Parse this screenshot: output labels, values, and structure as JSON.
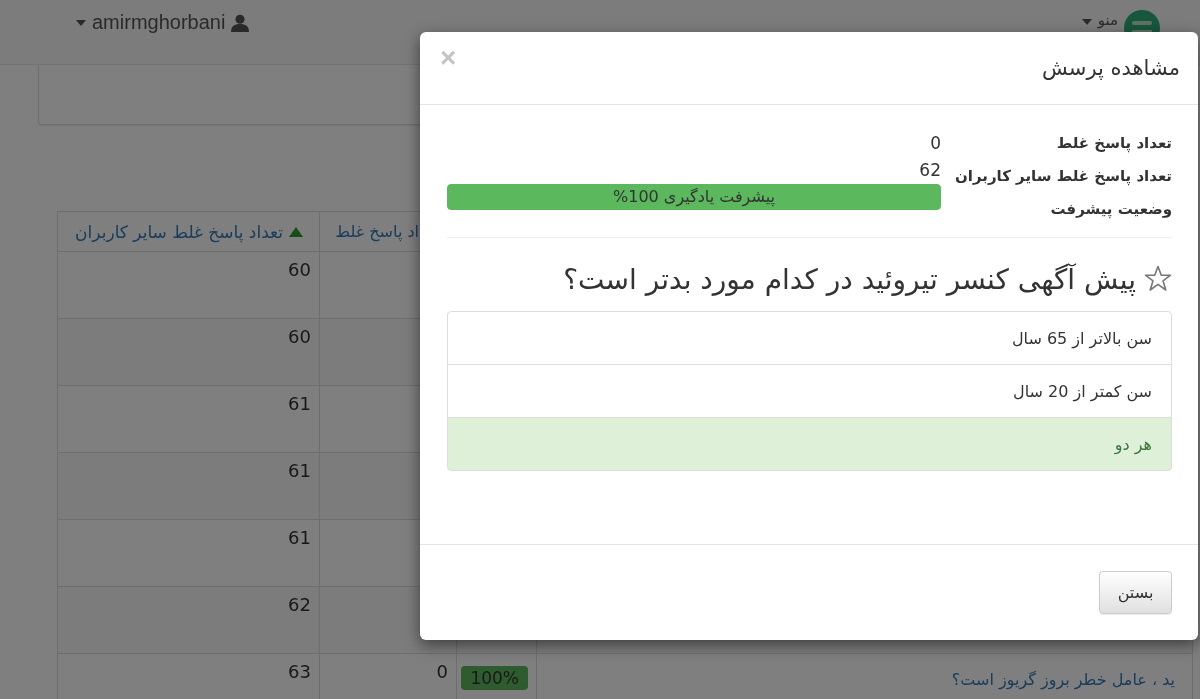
{
  "navbar": {
    "user": "amirmghorbani",
    "menu": "منو"
  },
  "table": {
    "columns": [
      {
        "label": "اد پاسخ غلط",
        "sorted": false
      },
      {
        "label": "تعداد پاسخ غلط سایر کاربران",
        "sorted": true
      }
    ],
    "rows": [
      {
        "others_wrong": "60"
      },
      {
        "others_wrong": "60"
      },
      {
        "others_wrong": "61"
      },
      {
        "others_wrong": "61"
      },
      {
        "others_wrong": "61"
      },
      {
        "others_wrong": "62"
      },
      {
        "question": "ید ، عامل خطر بروز گریوز است؟",
        "progress": "100%",
        "wrong": "0",
        "others_wrong": "63"
      }
    ]
  },
  "modal": {
    "title": "مشاهده پرسش",
    "close": "×",
    "stats": [
      {
        "kind": "text",
        "label": "تعداد پاسخ غلط",
        "value": "0"
      },
      {
        "kind": "text",
        "label": "تعداد پاسخ غلط سایر کاربران",
        "value": "62"
      },
      {
        "kind": "progress",
        "label": "وضعیت پیشرفت",
        "value": "پیشرفت یادگیری 100%",
        "level": 1
      }
    ],
    "question": {
      "text": "پیش آگهی کنسر تیروئید در کدام مورد بدتر است؟",
      "starred": false
    },
    "options": [
      {
        "text": "سن بالاتر از 65 سال",
        "correct": false
      },
      {
        "text": "سن کمتر از 20 سال",
        "correct": false
      },
      {
        "text": "هر دو",
        "correct": true
      }
    ],
    "buttons": [
      "بستن"
    ]
  }
}
